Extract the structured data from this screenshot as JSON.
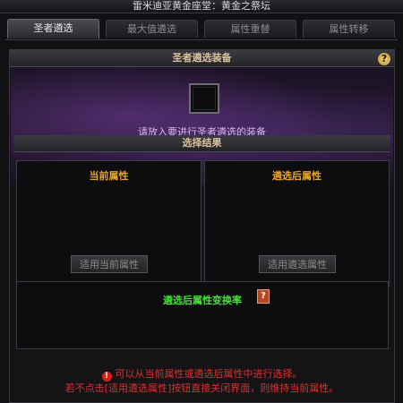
{
  "window": {
    "title": "雷米迪亚黄金座堂：黄金之祭坛"
  },
  "tabs": [
    {
      "label": "圣者遴选",
      "active": true
    },
    {
      "label": "最大值遴选",
      "active": false
    },
    {
      "label": "属性重替",
      "active": false
    },
    {
      "label": "属性转移",
      "active": false
    }
  ],
  "equipment_section": {
    "title": "圣者遴选装备",
    "help_label": "?",
    "hint": "请放入要进行圣者遴选的装备"
  },
  "result_section": {
    "title": "选择结果",
    "current": {
      "title": "当前属性",
      "button": "适用当前属性"
    },
    "selected": {
      "title": "遴选后属性",
      "button": "适用遴选属性"
    }
  },
  "rate_section": {
    "title": "遴选后属性变换率",
    "book_glyph": "?"
  },
  "notice": {
    "line1": "可以从当前属性或遴选后属性中进行选择。",
    "line2": "若不点击[适用遴选属性]按钮直接关闭界面，则维持当前属性。"
  },
  "colors": {
    "accent_gold": "#e8a52c",
    "rate_green": "#46e23a",
    "warning_red": "#e03030",
    "hint_purple": "#d6b8e8"
  }
}
